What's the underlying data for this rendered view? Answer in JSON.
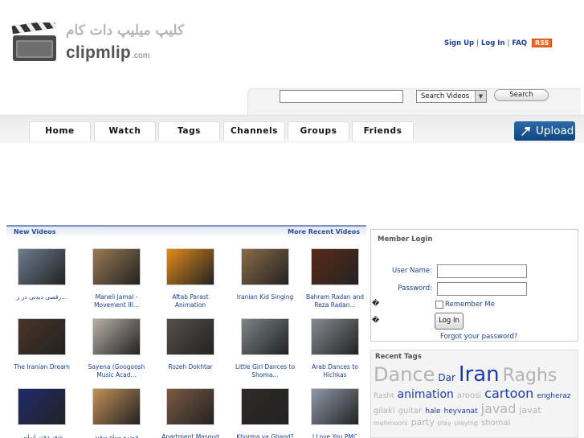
{
  "header": {
    "logo_fa": "کلیپ میلیپ دات کام",
    "logo_en": "clipmlip",
    "logo_suffix": ".com",
    "links": [
      "Sign Up",
      "Log In",
      "FAQ"
    ],
    "rss_label": "RSS",
    "icon_board": "clapperboard-icon"
  },
  "search": {
    "input_value": "",
    "select_value": "Search Videos",
    "button_label": "Search"
  },
  "nav": {
    "tabs": [
      "Home",
      "Watch",
      "Tags",
      "Channels",
      "Groups",
      "Friends"
    ],
    "upload_label": "Upload",
    "upload_icon": "upload-arrow-icon"
  },
  "videos": {
    "heading": "New Videos",
    "more_link": "More Recent Videos",
    "items": [
      {
        "title": "رقصی دیدنی در ز...",
        "thumb_color": "#6b7d8f"
      },
      {
        "title": "Maneli Jamal - Movement III...",
        "thumb_color": "#9a7a55"
      },
      {
        "title": "Aftab Parast Animation",
        "thumb_color": "#e08a1a"
      },
      {
        "title": "Iranian Kid Singing",
        "thumb_color": "#8c6a48"
      },
      {
        "title": "Bahram Radan and Reza Radan...",
        "thumb_color": "#5a2a18"
      },
      {
        "title": "The Iranian Dream",
        "thumb_color": "#4a3526"
      },
      {
        "title": "Sayena (Googoosh Music Acad...",
        "thumb_color": "#b8b0a6"
      },
      {
        "title": "Rozeh Dokhtar",
        "thumb_color": "#55504c"
      },
      {
        "title": "Little Girl Dances to Shoma...",
        "thumb_color": "#7a8588"
      },
      {
        "title": "Arab Dances to Hichkas",
        "thumb_color": "#868a90"
      },
      {
        "title": "شعر دختر ایرانی",
        "thumb_color": "#1e2a6e"
      },
      {
        "title": "خودرو سیاه سفید",
        "thumb_color": "#c29158"
      },
      {
        "title": "Apartment Masoud",
        "thumb_color": "#7d5a44"
      },
      {
        "title": "Khorma va Ghand?",
        "thumb_color": "#2e2a28"
      },
      {
        "title": "I Love You PMC",
        "thumb_color": "#8f98a8"
      }
    ]
  },
  "login": {
    "heading": "Member Login",
    "username_label": "User Name:",
    "password_label": "Password:",
    "username_value": "",
    "password_value": "",
    "remember_label": "Remember Me",
    "button_label": "Log In",
    "forgot_label": "Forgot your password?",
    "glyph": "�"
  },
  "tags": {
    "heading": "Recent Tags",
    "items": [
      {
        "text": "Dance",
        "size": 24,
        "color": "#b3b3b3"
      },
      {
        "text": "Dar",
        "size": 12,
        "color": "#1b3bb0"
      },
      {
        "text": "Iran",
        "size": 26,
        "color": "#1b3bb0"
      },
      {
        "text": "Raghs",
        "size": 22,
        "color": "#b3b3b3"
      },
      {
        "text": "Rasht",
        "size": 9,
        "color": "#b3b3b3"
      },
      {
        "text": "animation",
        "size": 14,
        "color": "#1b3bb0"
      },
      {
        "text": "aroosi",
        "size": 10,
        "color": "#b3b3b3"
      },
      {
        "text": "cartoon",
        "size": 16,
        "color": "#1b3bb0"
      },
      {
        "text": "engheraz",
        "size": 9,
        "color": "#1b3bb0"
      },
      {
        "text": "gilaki",
        "size": 10,
        "color": "#b3b3b3"
      },
      {
        "text": "guitar",
        "size": 10,
        "color": "#b3b3b3"
      },
      {
        "text": "hale",
        "size": 9,
        "color": "#1b3bb0"
      },
      {
        "text": "heyvanat",
        "size": 9,
        "color": "#1b3bb0"
      },
      {
        "text": "javad",
        "size": 16,
        "color": "#b3b3b3"
      },
      {
        "text": "javat",
        "size": 11,
        "color": "#b3b3b3"
      },
      {
        "text": "mehmooni",
        "size": 8,
        "color": "#b3b3b3"
      },
      {
        "text": "party",
        "size": 11,
        "color": "#b3b3b3"
      },
      {
        "text": "play",
        "size": 8,
        "color": "#b3b3b3"
      },
      {
        "text": "playing",
        "size": 8,
        "color": "#b3b3b3"
      },
      {
        "text": "shomal",
        "size": 10,
        "color": "#b3b3b3"
      }
    ]
  }
}
